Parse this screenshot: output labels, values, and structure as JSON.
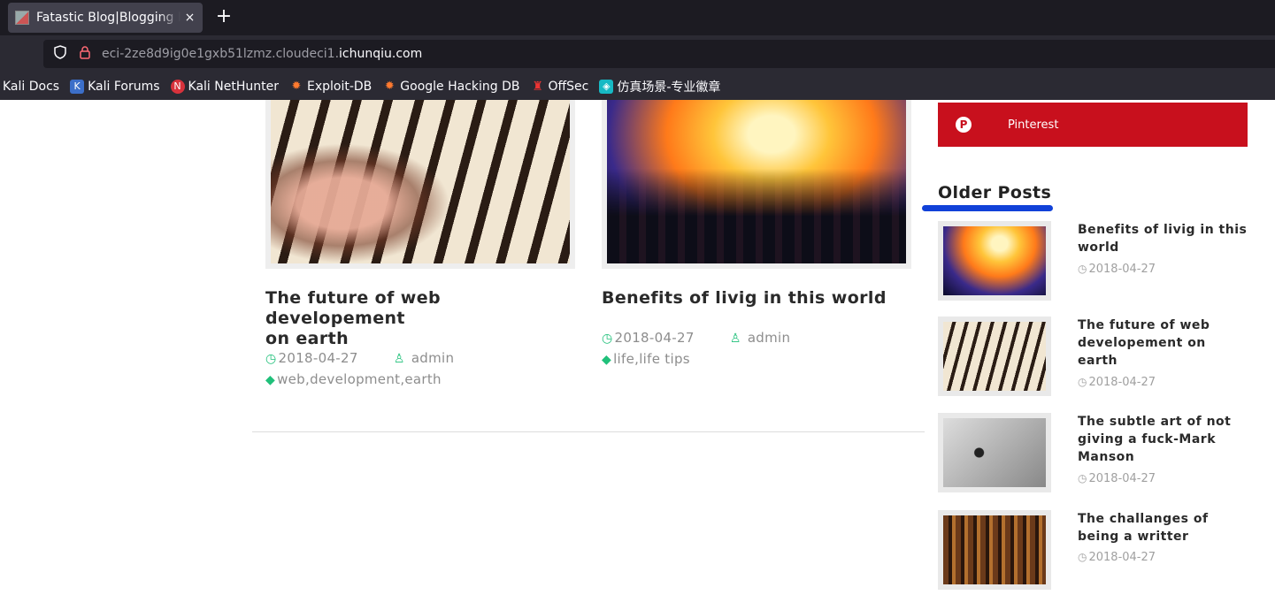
{
  "browser": {
    "tab_title": "Fatastic Blog|Blogging Fo",
    "tab_close": "×",
    "new_tab": "+",
    "url_prefix": "eci-2ze8d9ig0e1gxb51lzmz.cloudeci1.",
    "url_domain": "ichunqiu.com",
    "bookmarks": [
      {
        "label": "Kali Docs",
        "icon": ""
      },
      {
        "label": "Kali Forums",
        "icon": "K"
      },
      {
        "label": "Kali NetHunter",
        "icon": "N"
      },
      {
        "label": "Exploit-DB",
        "icon": "✹"
      },
      {
        "label": "Google Hacking DB",
        "icon": "✹"
      },
      {
        "label": "OffSec",
        "icon": "♜"
      },
      {
        "label": "仿真场景-专业徽章",
        "icon": "◈"
      }
    ]
  },
  "posts": [
    {
      "title_line1": "The future of web developement",
      "title_line2": "on earth",
      "date": "2018-04-27",
      "author": "admin",
      "tags": "web,development,earth"
    },
    {
      "title_line1": "Benefits of livig in this world",
      "date": "2018-04-27",
      "author": "admin",
      "tags": "life,life tips"
    }
  ],
  "icons": {
    "clock": "◷",
    "user": "♙",
    "tag": "◆"
  },
  "sidebar": {
    "pinterest_label": "Pinterest",
    "pinterest_icon": "P",
    "older_heading": "Older Posts",
    "items": [
      {
        "line1": "Benefits of livig in this",
        "line2": "world",
        "line3": "",
        "date": "2018-04-27"
      },
      {
        "line1": "The future of web",
        "line2": "developement on",
        "line3": "earth",
        "date": "2018-04-27"
      },
      {
        "line1": "The subtle art of not",
        "line2": "giving a fuck-Mark",
        "line3": "Manson",
        "date": "2018-04-27"
      },
      {
        "line1": "The challanges of",
        "line2": "being a writter",
        "line3": "",
        "date": "2018-04-27"
      }
    ]
  },
  "colors": {
    "accent_green": "#20c07a",
    "pinterest_red": "#c8101d",
    "underline_blue": "#1141d8"
  }
}
